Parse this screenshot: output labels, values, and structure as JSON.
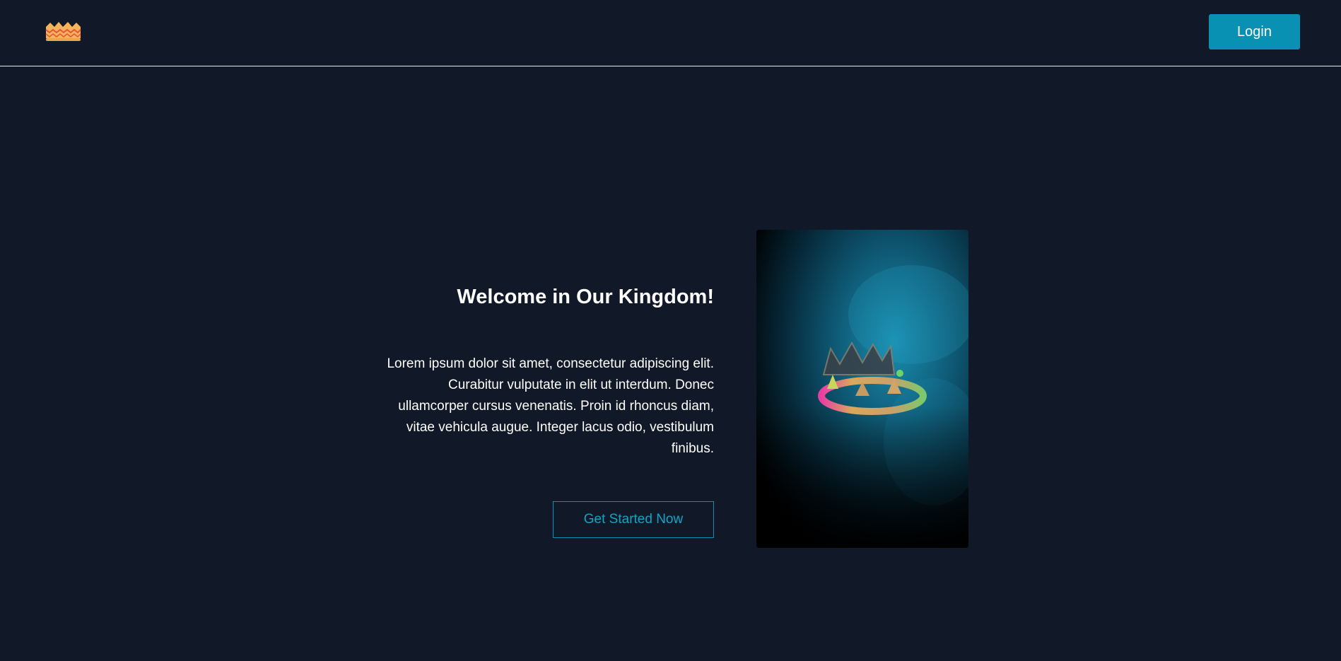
{
  "navbar": {
    "logo_icon": "crown-icon",
    "login_label": "Login"
  },
  "hero": {
    "title": "Welcome in Our Kingdom!",
    "body": "Lorem ipsum dolor sit amet, consectetur adipiscing elit. Curabitur vulputate in elit ut interdum. Donec ullamcorper cursus venenatis. Proin id rhoncus diam, vitae vehicula augue. Integer lacus odio, vestibulum finibus.",
    "cta_label": "Get Started Now",
    "image_icon": "crown-image"
  },
  "colors": {
    "background": "#111827",
    "accent": "#0891b2",
    "text": "#ffffff"
  }
}
